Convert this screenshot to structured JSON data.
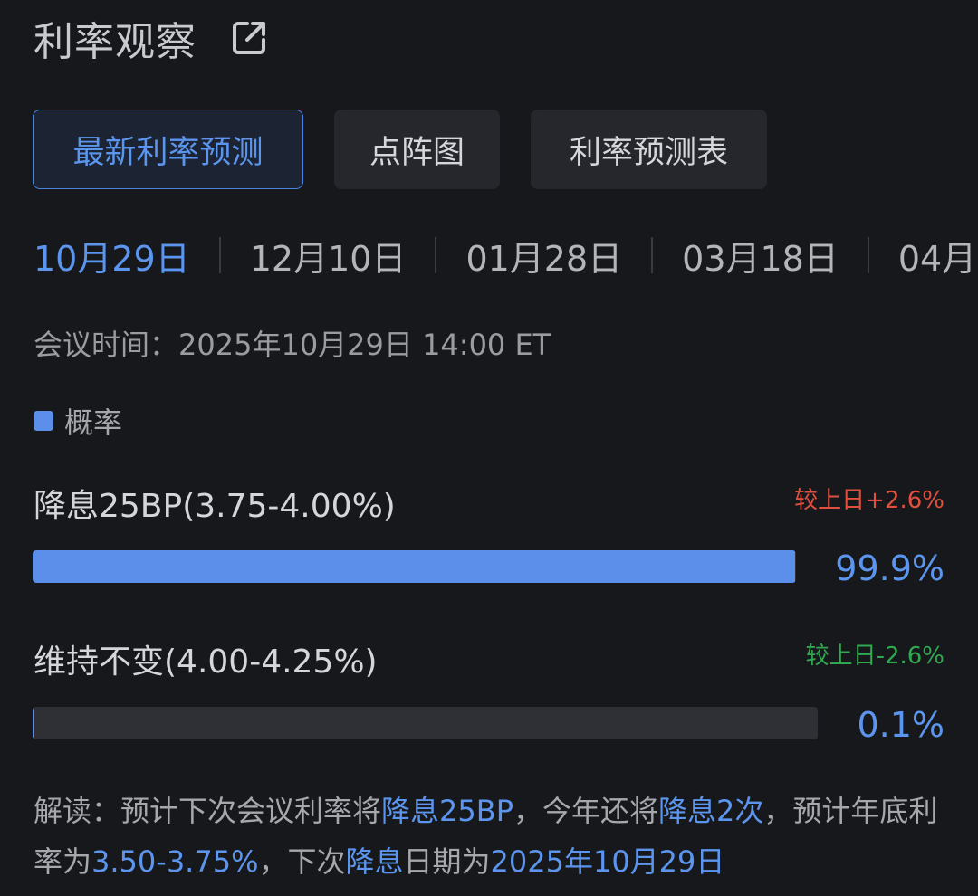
{
  "header": {
    "title": "利率观察",
    "icon": "external-link-icon"
  },
  "tabs": [
    {
      "label": "最新利率预测",
      "active": true
    },
    {
      "label": "点阵图",
      "active": false
    },
    {
      "label": "利率预测表",
      "active": false
    }
  ],
  "dates": [
    "10月29日",
    "12月10日",
    "01月28日",
    "03月18日",
    "04月"
  ],
  "meeting": {
    "label": "会议时间：",
    "value": "2025年10月29日 14:00 ET"
  },
  "legend": {
    "label": "概率",
    "color": "#5b8fe9"
  },
  "options": [
    {
      "label": "降息25BP(3.75-4.00%)",
      "delta": "较上日+2.6%",
      "delta_color": "#e0503f",
      "percent": "99.9%",
      "value": 99.9
    },
    {
      "label": "维持不变(4.00-4.25%)",
      "delta": "较上日-2.6%",
      "delta_color": "#2fa84f",
      "percent": "0.1%",
      "value": 0.1
    }
  ],
  "interpretation": {
    "p1": "解读：预计下次会议利率将",
    "h1": "降息25BP",
    "p2": "，今年还将",
    "h2": "降息2次",
    "p3": "，预计年底利率为",
    "h3": "3.50-3.75%",
    "p4": "，下次",
    "h4": "降息",
    "p5": "日期为",
    "h5": "2025年10月29日"
  },
  "colors": {
    "accent": "#5b95ee",
    "background": "#17181c",
    "up": "#e0503f",
    "down": "#2fa84f"
  }
}
